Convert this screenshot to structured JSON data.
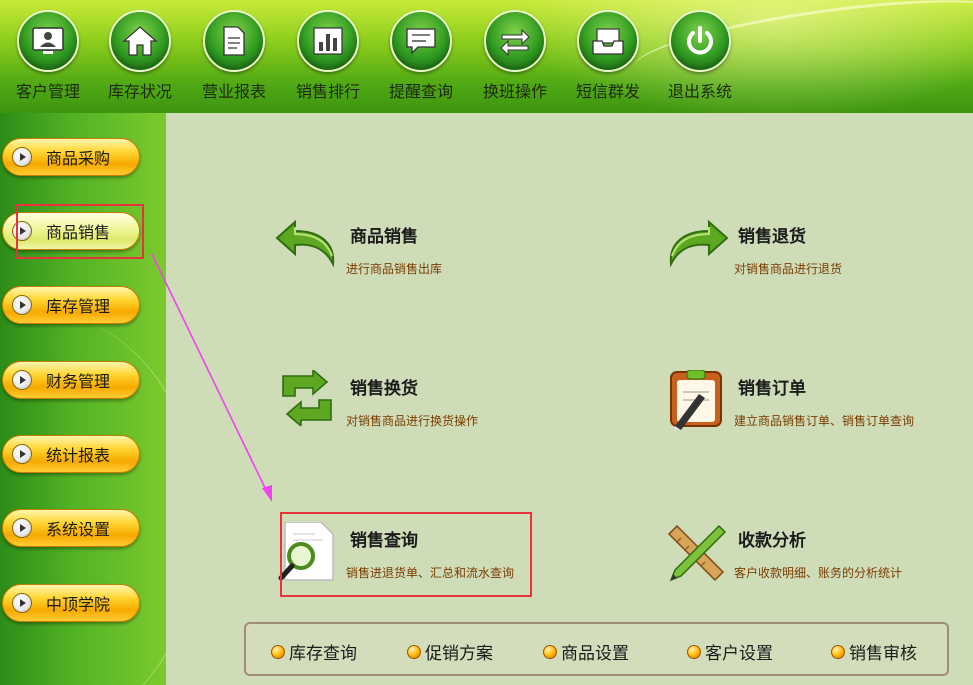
{
  "toolbar": {
    "items": [
      {
        "label": "客户管理",
        "icon": "customer-screen-icon"
      },
      {
        "label": "库存状况",
        "icon": "house-icon"
      },
      {
        "label": "营业报表",
        "icon": "report-doc-icon"
      },
      {
        "label": "销售排行",
        "icon": "bar-chart-icon"
      },
      {
        "label": "提醒查询",
        "icon": "speech-bubble-icon"
      },
      {
        "label": "换班操作",
        "icon": "swap-arrows-icon"
      },
      {
        "label": "短信群发",
        "icon": "inbox-tray-icon"
      },
      {
        "label": "退出系统",
        "icon": "power-icon"
      }
    ]
  },
  "sidebar": {
    "items": [
      {
        "label": "商品采购",
        "active": false
      },
      {
        "label": "商品销售",
        "active": true
      },
      {
        "label": "库存管理",
        "active": false
      },
      {
        "label": "财务管理",
        "active": false
      },
      {
        "label": "统计报表",
        "active": false
      },
      {
        "label": "系统设置",
        "active": false
      },
      {
        "label": "中顶学院",
        "active": false
      }
    ]
  },
  "features": [
    {
      "title": "商品销售",
      "desc": "进行商品销售出库",
      "icon": "undo-arrow-icon"
    },
    {
      "title": "销售退货",
      "desc": "对销售商品进行退货",
      "icon": "redo-arrow-icon"
    },
    {
      "title": "销售换货",
      "desc": "对销售商品进行换货操作",
      "icon": "recycle-arrows-icon"
    },
    {
      "title": "销售订单",
      "desc": "建立商品销售订单、销售订单查询",
      "icon": "clipboard-pen-icon"
    },
    {
      "title": "销售查询",
      "desc": "销售进退货单、汇总和流水查询",
      "icon": "magnifier-document-icon"
    },
    {
      "title": "收款分析",
      "desc": "客户收款明细、账务的分析统计",
      "icon": "ruler-pencil-icon"
    }
  ],
  "quickbar": {
    "items": [
      {
        "label": "库存查询"
      },
      {
        "label": "促销方案"
      },
      {
        "label": "商品设置"
      },
      {
        "label": "客户设置"
      },
      {
        "label": "销售审核"
      }
    ]
  },
  "colors": {
    "highlight": "#e8323c",
    "arrow": "#ee44ee",
    "desc_text": "#7a3d00"
  }
}
